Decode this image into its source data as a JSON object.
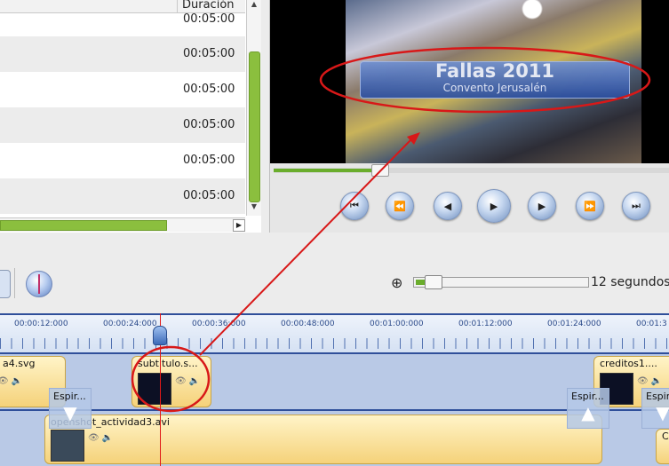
{
  "file_list": {
    "column_header": "Duración",
    "rows": [
      "00:05:00",
      "00:05:00",
      "00:05:00",
      "00:05:00",
      "00:05:00",
      "00:05:00"
    ]
  },
  "scrollbars": {
    "v_up": "▲",
    "v_down": "▼",
    "h_right": "▶"
  },
  "preview": {
    "subtitle_title": "Fallas 2011",
    "subtitle_sub": "Convento Jerusalén",
    "progress": 0.26,
    "controls": [
      {
        "name": "jump-start-button",
        "glyph": "⏮"
      },
      {
        "name": "previous-marker-button",
        "glyph": "⏪"
      },
      {
        "name": "rewind-button",
        "glyph": "◀"
      },
      {
        "name": "play-button",
        "glyph": "▶"
      },
      {
        "name": "fast-forward-button",
        "glyph": "▶"
      },
      {
        "name": "next-marker-button",
        "glyph": "⏩"
      },
      {
        "name": "jump-end-button",
        "glyph": "⏭"
      }
    ]
  },
  "toolbar": {
    "zoom_icon": "⊕",
    "zoom_label": "12 segundos",
    "zoom_value": 0.06
  },
  "timeline": {
    "ruler_labels": [
      "00:00:12:000",
      "00:00:24:000",
      "00:00:36:000",
      "00:00:48:000",
      "00:01:00:000",
      "00:01:12:000",
      "00:01:24:000",
      "00:01:3"
    ],
    "track1": {
      "clips": [
        {
          "name": "a4.svg"
        },
        {
          "name": "subtitulo.s..."
        },
        {
          "name": "creditos1...."
        }
      ]
    },
    "track2": {
      "clips": [
        {
          "name": "openshot_actividad3.avi"
        }
      ],
      "transitions": [
        {
          "label": "Espir..."
        },
        {
          "label": "Espir..."
        },
        {
          "label": "Espir..."
        }
      ]
    },
    "clip_icons": "👁 🔈",
    "overflow_label": "C"
  },
  "colors": {
    "accent_green": "#6aad2c",
    "annotation_red": "#e01818",
    "track_blue": "#2f4f9a"
  }
}
